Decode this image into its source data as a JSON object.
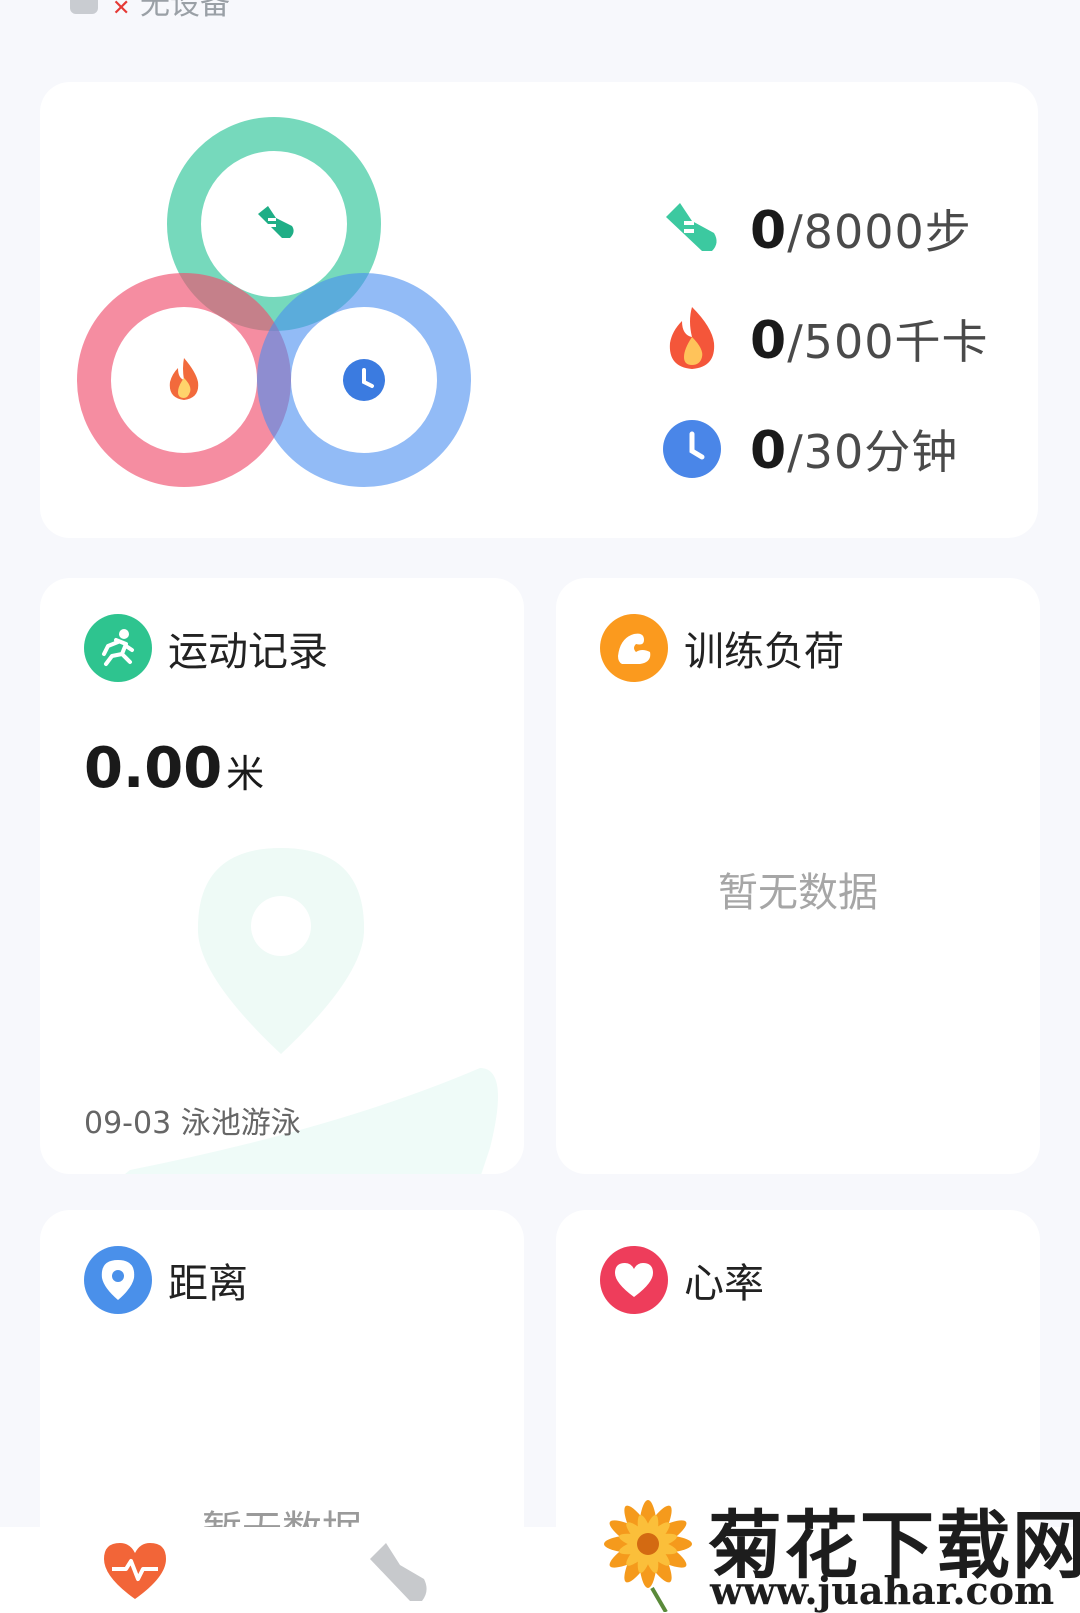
{
  "top_strip": {
    "device_status": "无设备"
  },
  "goals": {
    "steps": {
      "current": "0",
      "target": "/8000步",
      "color": "#3cc9a0"
    },
    "calories": {
      "current": "0",
      "target": "/500千卡",
      "color": "#f0506e"
    },
    "minutes": {
      "current": "0",
      "target": "/30分钟",
      "color": "#4a8ef0"
    }
  },
  "exercise_record": {
    "title": "运动记录",
    "distance_value": "0.00",
    "distance_unit": "米",
    "last_record": "09-03 泳池游泳"
  },
  "training_load": {
    "title": "训练负荷",
    "empty_text": "暂无数据"
  },
  "distance": {
    "title": "距离",
    "empty_text": "暂无数据"
  },
  "heart_rate": {
    "title": "心率"
  },
  "bottom_nav": {
    "tabs": [
      "health-icon",
      "exercise-shoe-icon"
    ]
  },
  "watermark": {
    "title": "菊花下载网",
    "url": "www.juahar.com"
  }
}
